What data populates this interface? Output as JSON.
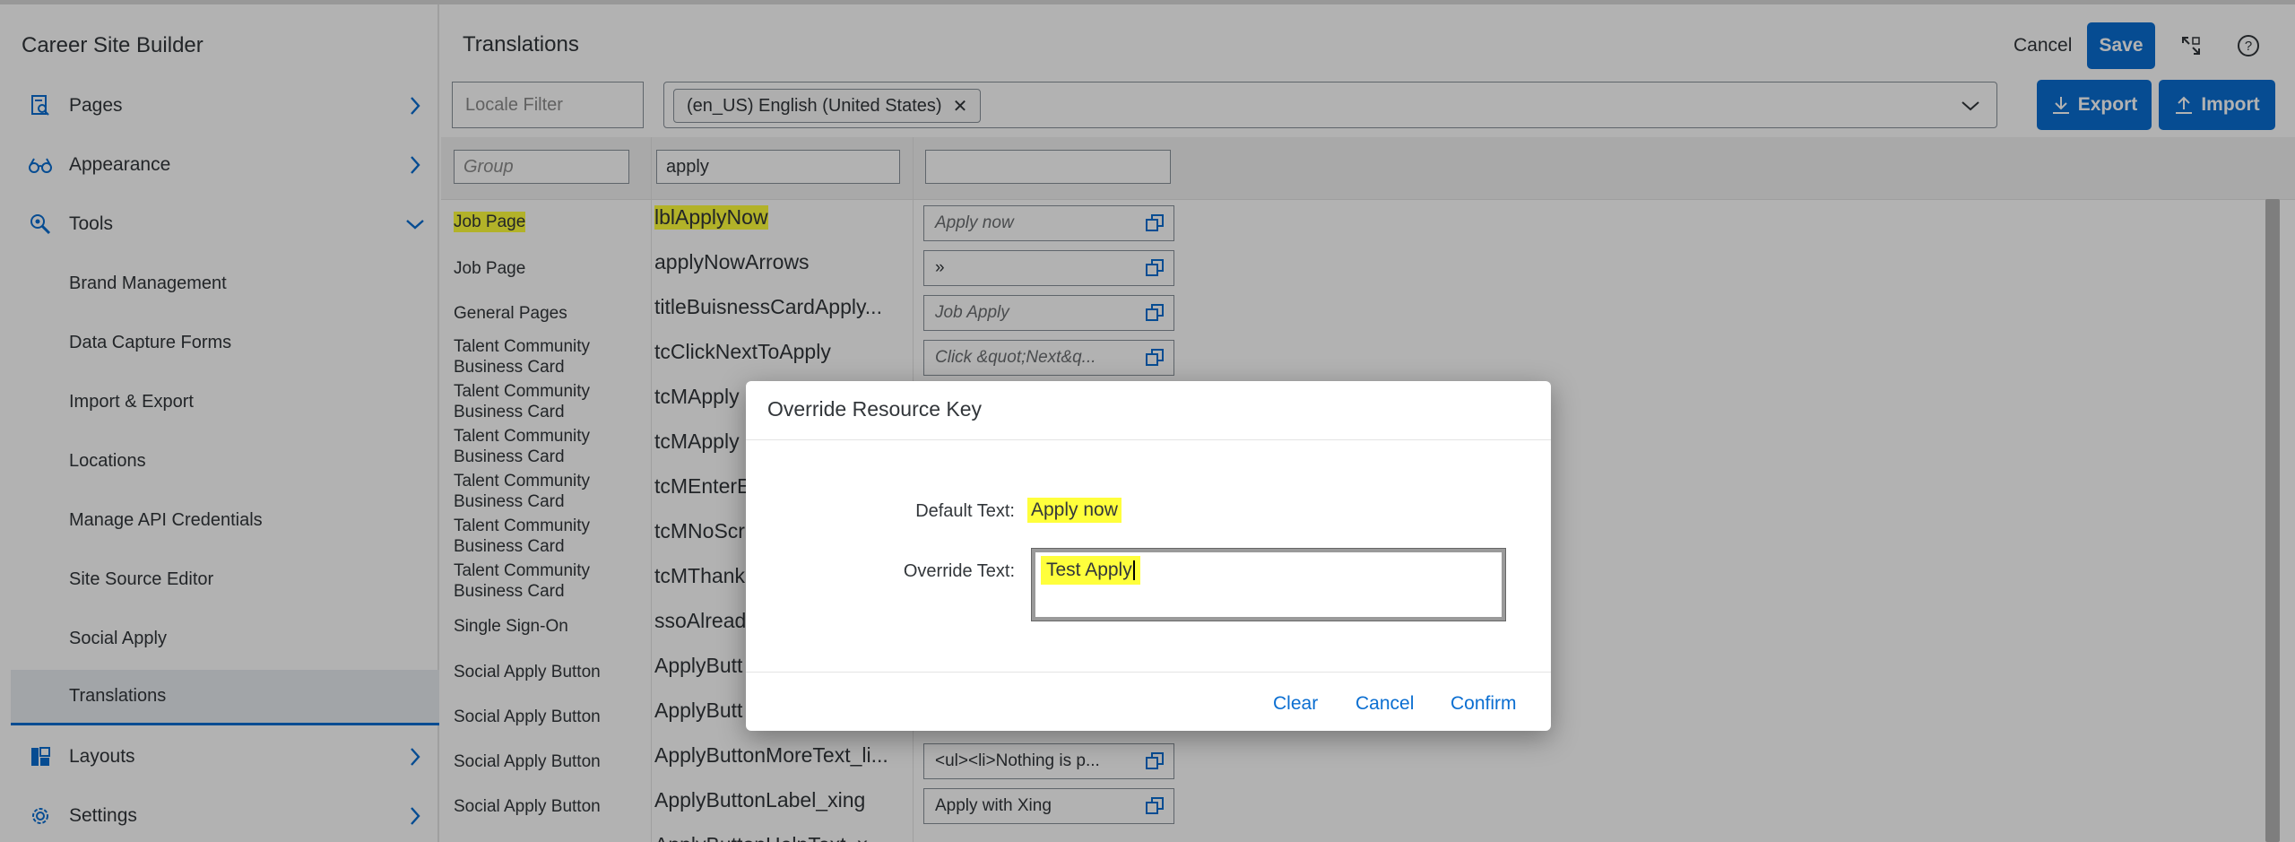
{
  "sidebar": {
    "title": "Career Site Builder",
    "items": [
      {
        "label": "Pages",
        "icon": "pages-icon"
      },
      {
        "label": "Appearance",
        "icon": "glasses-icon"
      },
      {
        "label": "Tools",
        "icon": "tools-search-icon"
      }
    ],
    "tools_sub": [
      "Brand Management",
      "Data Capture Forms",
      "Import & Export",
      "Locations",
      "Manage API Credentials",
      "Site Source Editor",
      "Social Apply",
      "Translations"
    ],
    "bottom_items": [
      {
        "label": "Layouts",
        "icon": "layouts-icon"
      },
      {
        "label": "Settings",
        "icon": "settings-gear-icon"
      }
    ]
  },
  "header": {
    "title": "Translations",
    "cancel_label": "Cancel",
    "save_label": "Save"
  },
  "filters": {
    "locale_placeholder": "Locale Filter",
    "locale_token": "(en_US) English (United States)",
    "export_label": "Export",
    "import_label": "Import",
    "group_placeholder": "Group",
    "key_filter_value": "apply"
  },
  "rows": [
    {
      "group": "Job Page",
      "key": "lblApplyNow",
      "value": "Apply now",
      "placeholder": true
    },
    {
      "group": "Job Page",
      "key": "applyNowArrows",
      "value": "»",
      "placeholder": false
    },
    {
      "group": "General Pages",
      "key": "titleBuisnessCardApply...",
      "value": "Job Apply",
      "placeholder": true
    },
    {
      "group": "Talent Community Business Card",
      "key": "tcClickNextToApply",
      "value": "Click &quot;Next&q...",
      "placeholder": true
    },
    {
      "group": "Talent Community Business Card",
      "key": "tcMApply",
      "value": "",
      "placeholder": true
    },
    {
      "group": "Talent Community Business Card",
      "key": "tcMApply",
      "value": "",
      "placeholder": true
    },
    {
      "group": "Talent Community Business Card",
      "key": "tcMEnterE",
      "value": "",
      "placeholder": true
    },
    {
      "group": "Talent Community Business Card",
      "key": "tcMNoScr",
      "value": "",
      "placeholder": true
    },
    {
      "group": "Talent Community Business Card",
      "key": "tcMThank",
      "value": "",
      "placeholder": true
    },
    {
      "group": "Single Sign-On",
      "key": "ssoAlread",
      "value": "",
      "placeholder": true
    },
    {
      "group": "Social Apply Button",
      "key": "ApplyButt",
      "value": "",
      "placeholder": true
    },
    {
      "group": "Social Apply Button",
      "key": "ApplyButt",
      "value": "",
      "placeholder": true
    },
    {
      "group": "Social Apply Button",
      "key": "ApplyButtonMoreText_li...",
      "value": "<ul><li>Nothing is p...",
      "placeholder": false
    },
    {
      "group": "Social Apply Button",
      "key": "ApplyButtonLabel_xing",
      "value": "Apply with Xing",
      "placeholder": false
    },
    {
      "group": "",
      "key": "ApplyButtonHelpText_x...",
      "value": "",
      "placeholder": true
    }
  ],
  "dialog": {
    "title": "Override Resource Key",
    "default_label": "Default Text:",
    "default_value": "Apply now",
    "override_label": "Override Text:",
    "override_value": "Test Apply",
    "clear_label": "Clear",
    "cancel_label": "Cancel",
    "confirm_label": "Confirm"
  },
  "colors": {
    "accent": "#0a6ed1",
    "highlight": "#ffff3c"
  }
}
